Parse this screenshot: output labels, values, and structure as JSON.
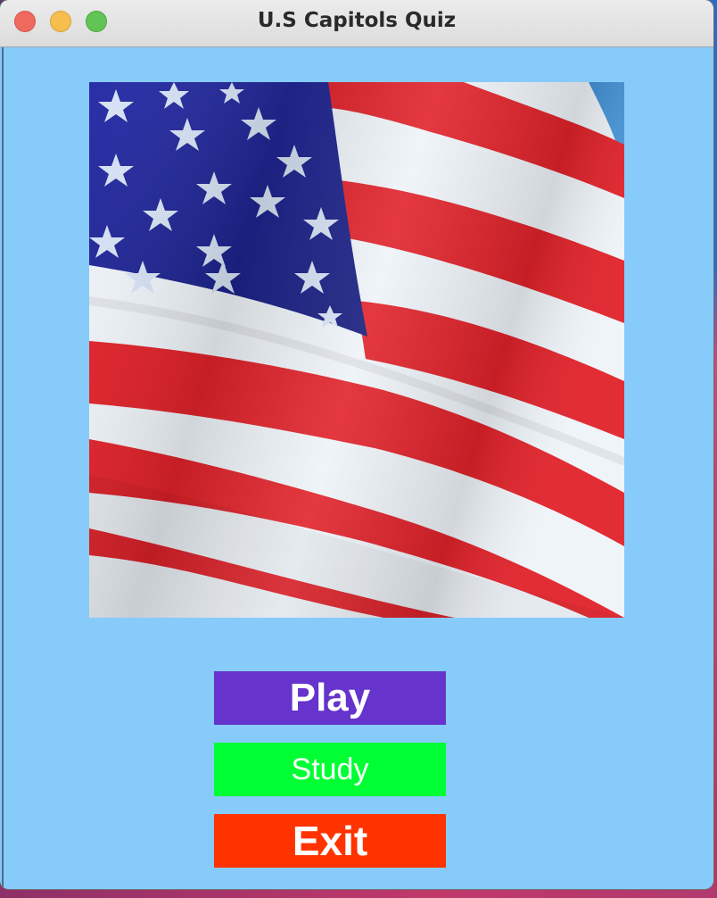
{
  "window": {
    "title": "U.S Capitols Quiz",
    "background_color": "#87cbfb"
  },
  "image": {
    "name": "american-flag",
    "description_icon": "us-flag-icon"
  },
  "buttons": {
    "play": {
      "label": "Play",
      "color": "#6633cc"
    },
    "study": {
      "label": "Study",
      "color": "#00ff33"
    },
    "exit": {
      "label": "Exit",
      "color": "#ff3300"
    }
  }
}
